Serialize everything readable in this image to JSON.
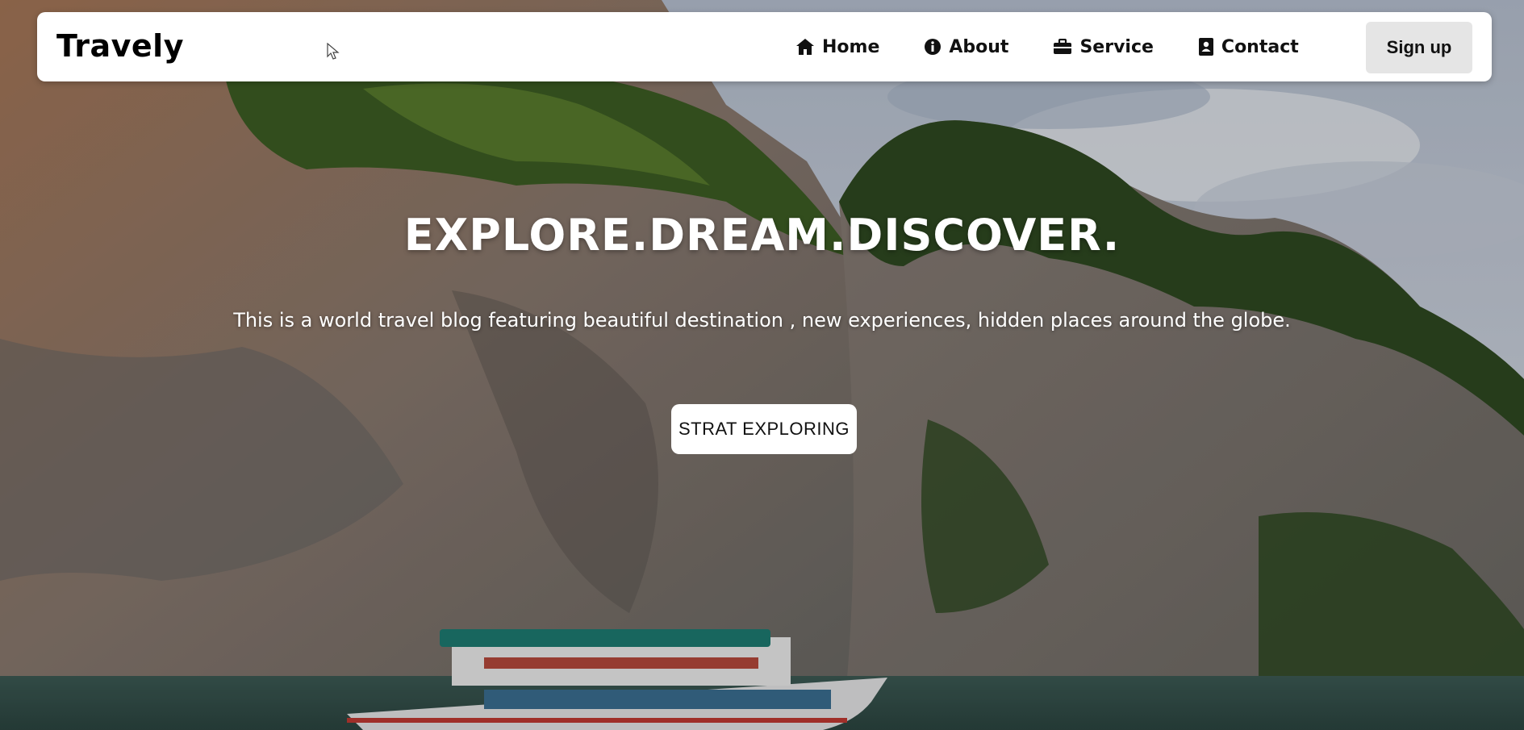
{
  "navbar": {
    "brand": "Travely",
    "links": [
      {
        "label": "Home",
        "icon": "home-icon"
      },
      {
        "label": "About",
        "icon": "info-circle-icon"
      },
      {
        "label": "Service",
        "icon": "briefcase-icon"
      },
      {
        "label": "Contact",
        "icon": "contact-card-icon"
      }
    ],
    "signup_label": "Sign up"
  },
  "hero": {
    "title": "EXPLORE.DREAM.DISCOVER.",
    "subtitle": "This is a world travel blog featuring beautiful destination , new experiences, hidden places around the globe.",
    "cta_label": "STRAT EXPLORING",
    "background": "limestone-cliffs-boat-photo"
  },
  "colors": {
    "navbar_bg": "#ffffff",
    "signup_bg": "#e5e5e5",
    "cta_bg": "#ffffff",
    "hero_text": "#ffffff"
  }
}
